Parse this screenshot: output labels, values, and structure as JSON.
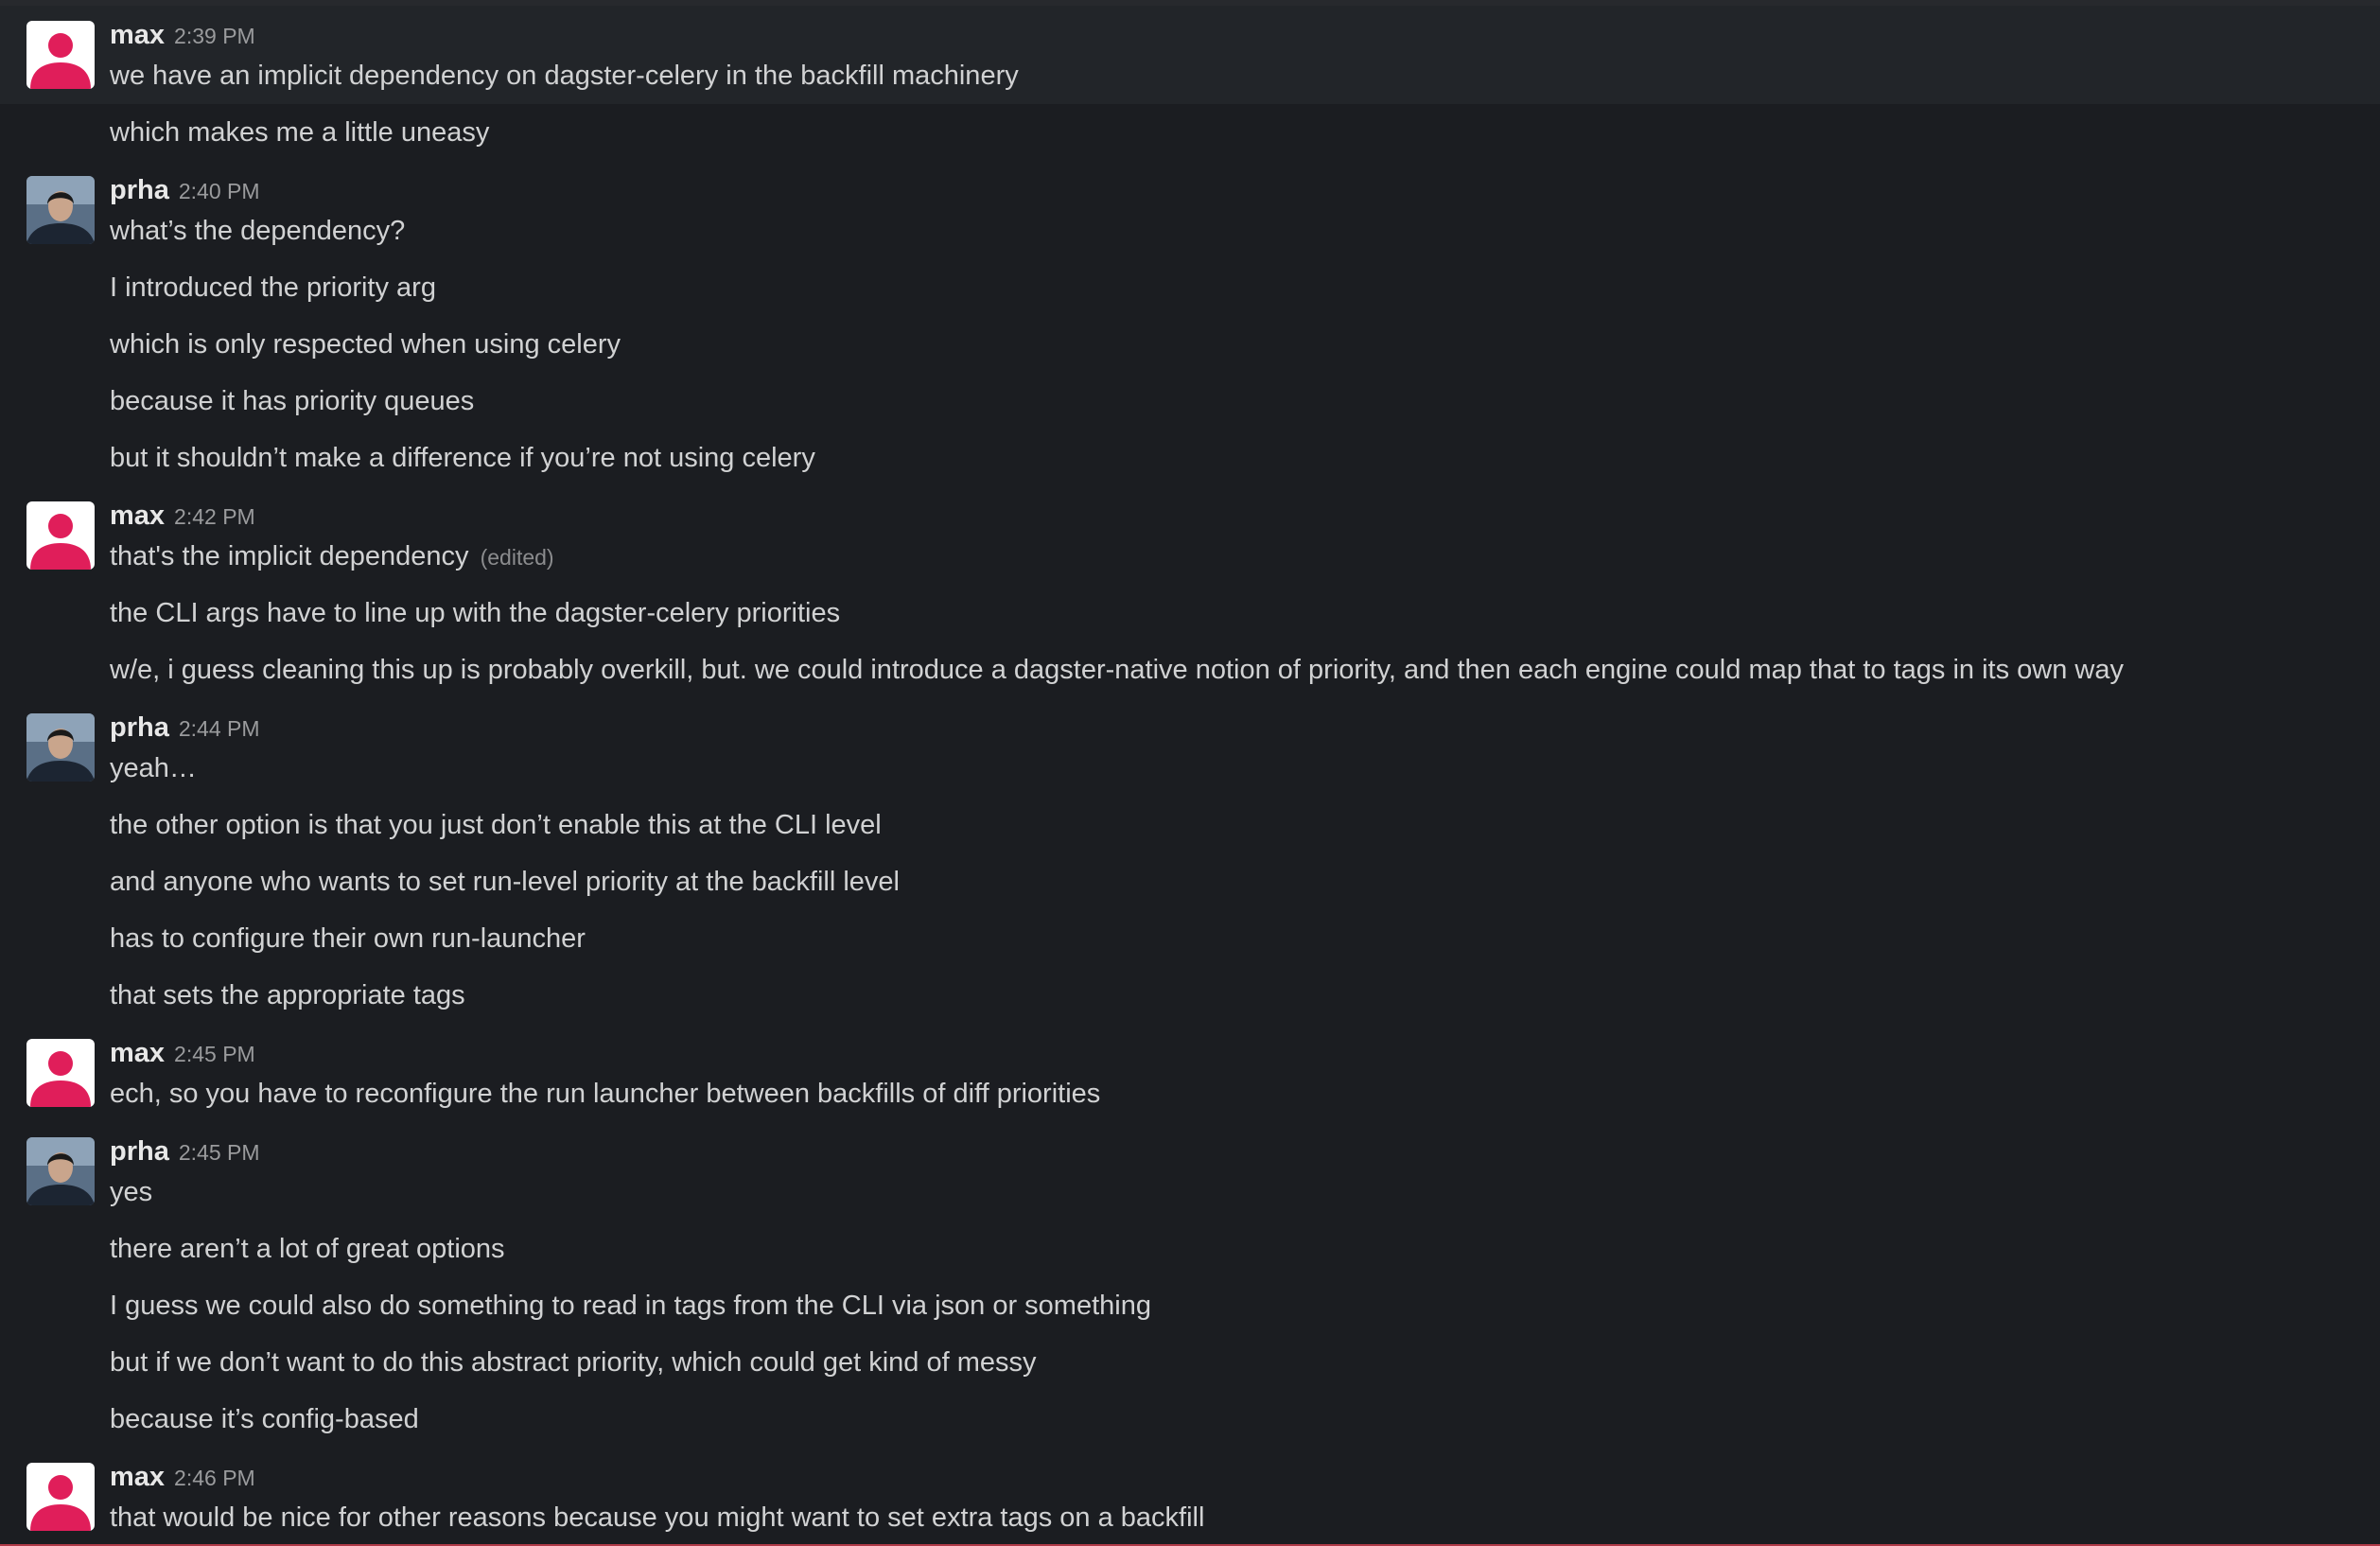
{
  "messages": [
    {
      "author": "max",
      "time": "2:39 PM",
      "avatar": "default-user-icon",
      "lines": [
        "we have an implicit dependency on dagster-celery in the backfill machinery",
        "which makes me a little uneasy"
      ]
    },
    {
      "author": "prha",
      "time": "2:40 PM",
      "avatar": "photo-avatar",
      "lines": [
        "what’s the dependency?",
        "I introduced the priority arg",
        "which is only respected when using celery",
        "because it has priority queues",
        "but it shouldn’t make a difference if you’re not using celery"
      ]
    },
    {
      "author": "max",
      "time": "2:42 PM",
      "avatar": "default-user-icon",
      "edited_label": "(edited)",
      "lines": [
        "that's the implicit dependency",
        "the CLI args have to line up with the dagster-celery priorities",
        "w/e, i guess cleaning this up is probably overkill, but. we could introduce a dagster-native notion of priority, and then each engine could map that to tags in its own way"
      ]
    },
    {
      "author": "prha",
      "time": "2:44 PM",
      "avatar": "photo-avatar",
      "lines": [
        "yeah…",
        "the other option is that you just don’t enable this at the CLI level",
        "and anyone who wants to set run-level priority at the backfill level",
        "has to configure their own run-launcher",
        "that sets the appropriate tags"
      ]
    },
    {
      "author": "max",
      "time": "2:45 PM",
      "avatar": "default-user-icon",
      "lines": [
        "ech, so you have to reconfigure the run launcher between backfills of diff priorities"
      ]
    },
    {
      "author": "prha",
      "time": "2:45 PM",
      "avatar": "photo-avatar",
      "lines": [
        "yes",
        "there aren’t a lot of great options",
        "I guess we could also do something to read in tags from the CLI via json or something",
        "but if we don’t want to do this abstract priority, which could get kind of messy",
        "because it’s config-based"
      ]
    },
    {
      "author": "max",
      "time": "2:46 PM",
      "avatar": "default-user-icon",
      "lines": [
        "that would be nice for other reasons because you might want to set extra tags on a backfill"
      ]
    }
  ],
  "colors": {
    "background": "#1b1d21",
    "hover_row": "#222529",
    "text": "#d1d2d3",
    "timestamp": "#9a9b9d",
    "default_avatar": "#e01e5a"
  }
}
